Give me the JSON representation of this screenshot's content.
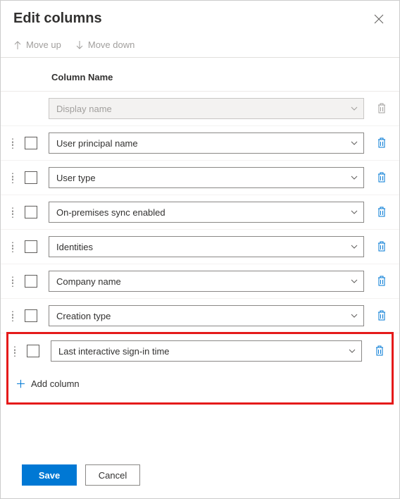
{
  "title": "Edit columns",
  "toolbar": {
    "move_up": "Move up",
    "move_down": "Move down"
  },
  "column_header": "Column Name",
  "locked_row": {
    "label": "Display name"
  },
  "rows": [
    {
      "label": "User principal name"
    },
    {
      "label": "User type"
    },
    {
      "label": "On-premises sync enabled"
    },
    {
      "label": "Identities"
    },
    {
      "label": "Company name"
    },
    {
      "label": "Creation type"
    }
  ],
  "highlighted_row": {
    "label": "Last interactive sign-in time"
  },
  "add_label": "Add column",
  "footer": {
    "save": "Save",
    "cancel": "Cancel"
  }
}
